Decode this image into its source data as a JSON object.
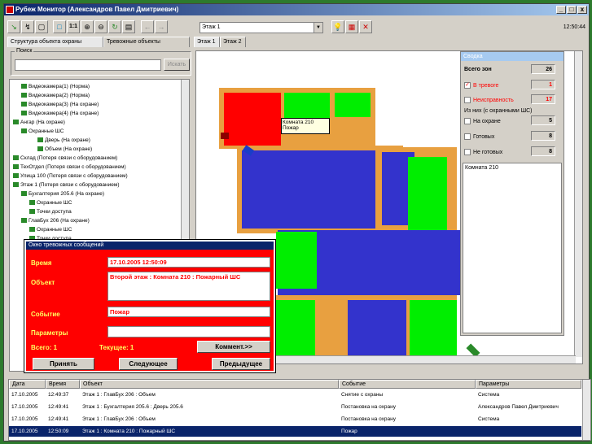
{
  "window": {
    "title": "Рубеж Монитор (Александров Павел Дмитриевич)",
    "minimize": "_",
    "maximize": "□",
    "close": "x"
  },
  "toolbar": {
    "floor_select": "Этаж 1",
    "clock": "12:50:44"
  },
  "left_tabs": [
    "Структура объекта охраны",
    "Тревожные объекты"
  ],
  "map_tabs": [
    "Этаж 1",
    "Этаж 2"
  ],
  "search": {
    "label": "Поиск",
    "placeholder": "",
    "button": "Искать"
  },
  "tree": [
    {
      "text": "Видеокамера(1)   (Норма)",
      "indent": 1
    },
    {
      "text": "Видеокамера(2)   (Норма)",
      "indent": 1
    },
    {
      "text": "Видеокамера(3)   (На охране)",
      "indent": 1
    },
    {
      "text": "Видеокамера(4)   (На охране)",
      "indent": 1
    },
    {
      "text": "Ангар   (На охране)",
      "indent": 0
    },
    {
      "text": "Охранные ШС",
      "indent": 1
    },
    {
      "text": "Дверь    (На охране)",
      "indent": 3
    },
    {
      "text": "Объем    (На охране)",
      "indent": 3
    },
    {
      "text": "Склад   (Потеря связи с оборудованием)",
      "indent": 0
    },
    {
      "text": "ТехОтдел   (Потеря связи с оборудованием)",
      "indent": 0
    },
    {
      "text": "Улица 100   (Потеря связи с оборудованием)",
      "indent": 0
    },
    {
      "text": "Этаж 1   (Потеря связи с оборудованием)",
      "indent": 0
    },
    {
      "text": "Бухгалтерия 205.6   (На охране)",
      "indent": 1
    },
    {
      "text": "Охранные ШС",
      "indent": 2
    },
    {
      "text": "Точки доступа",
      "indent": 2
    },
    {
      "text": "ГлавБух 206   (На охране)",
      "indent": 1
    },
    {
      "text": "Охранные ШС",
      "indent": 2
    },
    {
      "text": "Точки доступа",
      "indent": 2
    }
  ],
  "alarm": {
    "title": "Окно тревожных сообщений",
    "time_label": "Время",
    "time_value": "17.10.2005 12:50:09",
    "object_label": "Объект",
    "object_value": "Второй этаж : Комната 210 : Пожарный ШС",
    "event_label": "Событие",
    "event_value": "Пожар",
    "params_label": "Параметры",
    "params_value": "",
    "total": "Всего: 1",
    "current": "Текущее: 1",
    "comment_button": "Коммент.>>",
    "accept_button": "Принять",
    "next_button": "Следующее",
    "prev_button": "Предыдущее"
  },
  "map": {
    "tooltip_line1": "Комната 210",
    "tooltip_line2": "Пожар"
  },
  "summary": {
    "title": "Сводка",
    "total_zones_label": "Всего зон",
    "total_zones": "26",
    "alarm_label": "В тревоге",
    "alarm_value": "1",
    "fault_label": "Неисправность",
    "fault_value": "17",
    "group_label": "Из них (с охранными ШС)",
    "guarded_label": "На охране",
    "guarded_value": "5",
    "ready_label": "Готовых",
    "ready_value": "8",
    "notready_label": "Не готовых",
    "notready_value": "8",
    "selected": "Комната 210"
  },
  "events": {
    "headers": [
      "Дата",
      "Время",
      "Объект",
      "Событие",
      "Параметры"
    ],
    "rows": [
      [
        "17.10.2005",
        "12:49:37",
        "Этаж 1 : ГлавБух 206 : Объем",
        "Снятие с охраны",
        "Система"
      ],
      [
        "17.10.2005",
        "12:49:41",
        "Этаж 1 : Бухгалтерия 205.6 : Дверь 205.6",
        "Постановка на охрану",
        "Александров Павел Дмитриевич"
      ],
      [
        "17.10.2005",
        "12:49:41",
        "Этаж 1 : ГлавБух 206 : Объем",
        "Постановка на охрану",
        "Система"
      ],
      [
        "17.10.2005",
        "12:50:09",
        "Этаж 1 : Комната 210 : Пожарный ШС",
        "Пожар",
        ""
      ]
    ]
  },
  "colors": {
    "alarm": "#ff0000",
    "guarded": "#00ee00",
    "lost": "#3333cc",
    "selection": "#0a246a"
  }
}
